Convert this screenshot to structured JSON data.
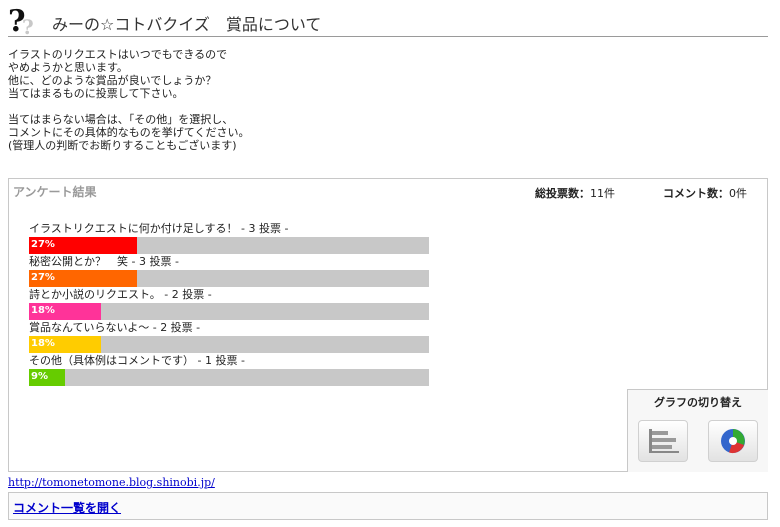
{
  "page": {
    "title": "みーの☆コトバクイズ　賞品について",
    "intro": "イラストのリクエストはいつでもできるので\nやめようかと思います。\n他に、どのような賞品が良いでしょうか？\n当てはまるものに投票して下さい。\n\n当てはまらない場合は、「その他」を選択し、\nコメントにその具体的なものを挙げてください。\n(管理人の判断でお断りすることもございます)"
  },
  "poll": {
    "heading": "アンケート結果",
    "total_label": "総投票数：",
    "total_value": "11件",
    "comment_label": "コメント数：",
    "comment_value": "0件",
    "options": [
      {
        "label": "イラストリクエストに何か付け足しする！ - 3 投票 -",
        "percent_text": "27%",
        "percent": 27,
        "color": "#ff0000"
      },
      {
        "label": "秘密公開とか？　笑 - 3 投票 -",
        "percent_text": "27%",
        "percent": 27,
        "color": "#ff6600"
      },
      {
        "label": "詩とか小説のリクエスト。 - 2 投票 -",
        "percent_text": "18%",
        "percent": 18,
        "color": "#ff3399"
      },
      {
        "label": "賞品なんていらないよ～ - 2 投票 -",
        "percent_text": "18%",
        "percent": 18,
        "color": "#ffcc00"
      },
      {
        "label": "その他（具体例はコメントです） - 1 投票 -",
        "percent_text": "9%",
        "percent": 9,
        "color": "#66cc00"
      }
    ]
  },
  "switcher": {
    "title": "グラフの切り替え",
    "bar_icon": "bar-chart-icon",
    "pie_icon": "pie-chart-icon"
  },
  "footer": {
    "blog_url": "http://tomonetomone.blog.shinobi.jp/",
    "comment_link": "コメント一覧を開く"
  }
}
